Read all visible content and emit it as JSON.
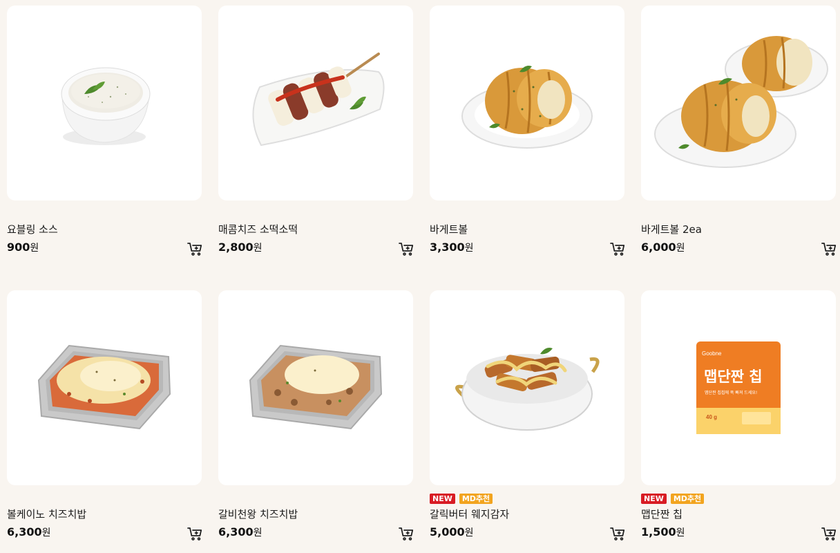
{
  "currency_unit": "원",
  "products": [
    {
      "name": "요블링 소스",
      "price": "900",
      "badges": []
    },
    {
      "name": "매콤치즈 소떡소떡",
      "price": "2,800",
      "badges": []
    },
    {
      "name": "바게트볼",
      "price": "3,300",
      "badges": []
    },
    {
      "name": "바게트볼 2ea",
      "price": "6,000",
      "badges": []
    },
    {
      "name": "볼케이노 치즈치밥",
      "price": "6,300",
      "badges": []
    },
    {
      "name": "갈비천왕 치즈치밥",
      "price": "6,300",
      "badges": []
    },
    {
      "name": "갈릭버터 웨지감자",
      "price": "5,000",
      "badges": [
        "NEW",
        "MD추천"
      ]
    },
    {
      "name": "맵단짠 칩",
      "price": "1,500",
      "badges": [
        "NEW",
        "MD추천"
      ]
    }
  ],
  "chip_pack": {
    "brand": "Goobne",
    "title": "맵단짠 칩",
    "tagline": "맵단짠 칩칩에 푹 빠져 드세요!",
    "weight": "40 g"
  },
  "colors": {
    "background": "#f9f5f0",
    "badge_new": "#d81c24",
    "badge_md": "#f2a41f"
  },
  "icons": {
    "cart": "cart-icon"
  }
}
